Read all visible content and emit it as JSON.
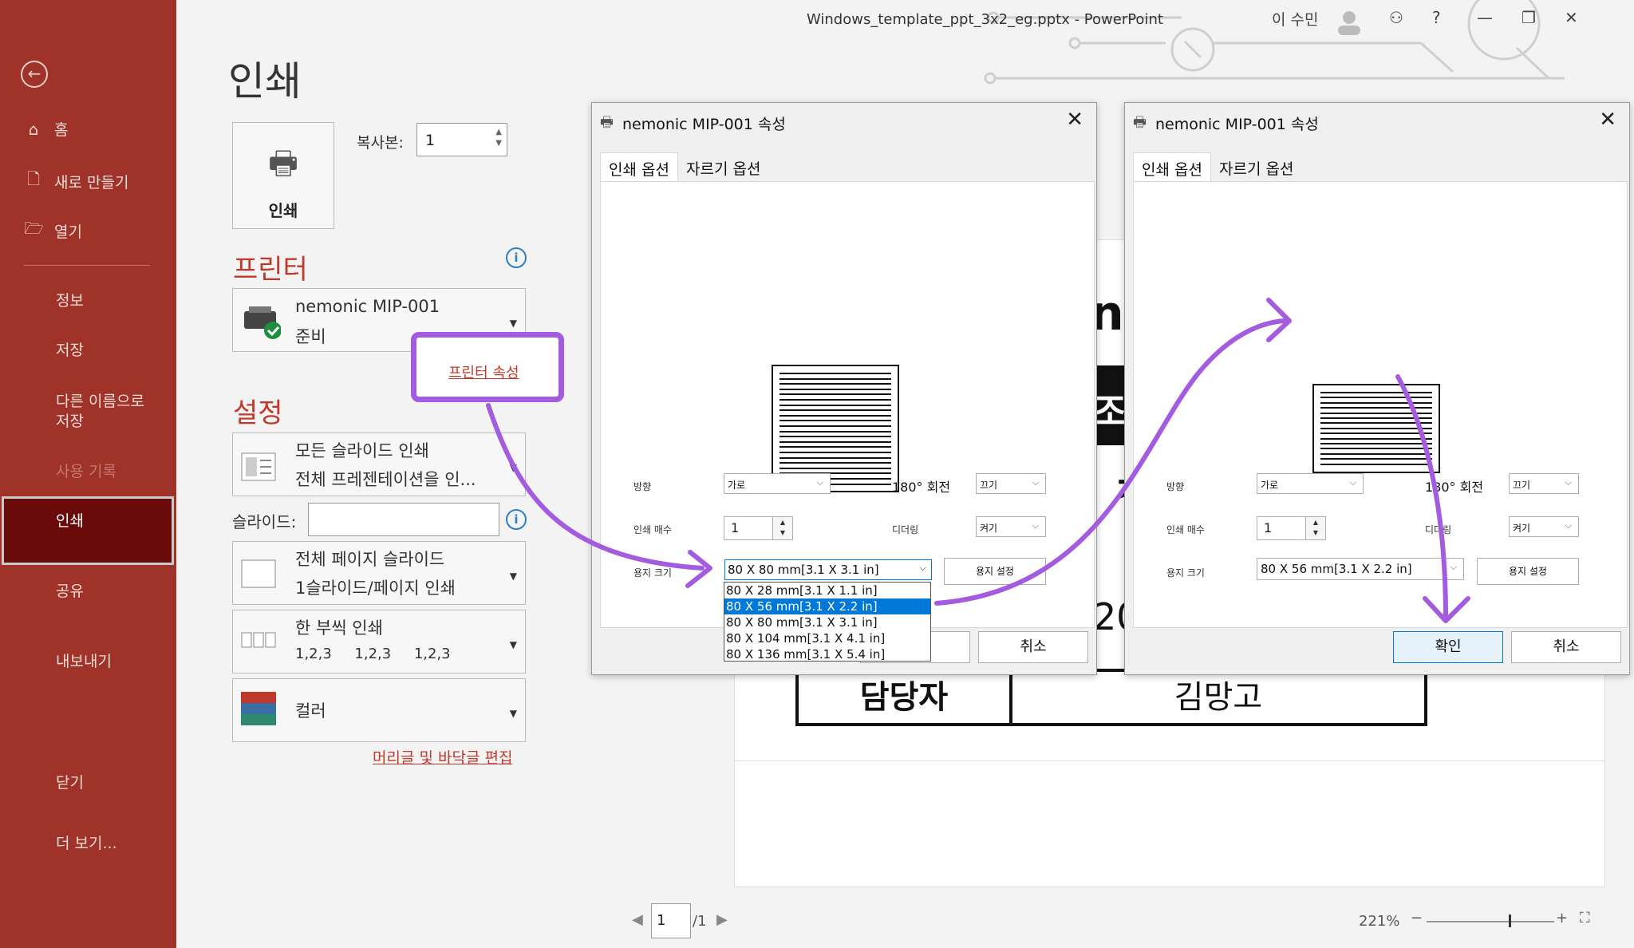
{
  "window": {
    "title": "Windows_template_ppt_3x2_eg.pptx  -  PowerPoint",
    "user": "이 수민"
  },
  "sidebar": {
    "home": "홈",
    "new": "새로 만들기",
    "open": "열기",
    "info": "정보",
    "save": "저장",
    "save_as_1": "다른 이름으로",
    "save_as_2": "저장",
    "history": "사용 기록",
    "print": "인쇄",
    "share": "공유",
    "export": "내보내기",
    "close": "닫기",
    "more": "더 보기..."
  },
  "print_page": {
    "title": "인쇄",
    "print_button": "인쇄",
    "copies_label": "복사본:",
    "copies_value": "1",
    "printer_heading": "프린터",
    "printer_name": "nemonic MIP-001",
    "printer_status": "준비",
    "printer_properties": "프린터 속성",
    "settings_heading": "설정",
    "slides_range_1": "모든 슬라이드 인쇄",
    "slides_range_2": "전체 프레젠테이션을 인...",
    "slides_label": "슬라이드:",
    "layout_1": "전체 페이지 슬라이드",
    "layout_2": "1슬라이드/페이지 인쇄",
    "collate_1": "한 부씩 인쇄",
    "collate_2": "1,2,3     1,2,3     1,2,3",
    "color": "컬러",
    "header_footer": "머리글 및 바닥글 편집",
    "page_value": "1",
    "page_total": "/1",
    "zoom": "221%"
  },
  "preview": {
    "cell_left": "담당자",
    "cell_right": "김망고",
    "fragment_no": "nc",
    "fragment_jo": "조",
    "fragment_ch": "ㅊ",
    "fragment_20": "20"
  },
  "dialog_left": {
    "title": "nemonic MIP-001 속성",
    "tab_print": "인쇄 옵션",
    "tab_cut": "자르기 옵션",
    "orientation_label": "방향",
    "orientation_value": "가로",
    "rotate_label": "180° 회전",
    "rotate_value": "끄기",
    "copies_label": "인쇄 매수",
    "copies_value": "1",
    "dither_label": "디더링",
    "dither_value": "켜기",
    "paper_label": "용지 크기",
    "paper_value": "80 X 80 mm[3.1 X 3.1 in]",
    "paper_setup": "용지 설정",
    "cancel": "취소",
    "paper_options": [
      "80 X 28 mm[3.1 X 1.1 in]",
      "80 X 56 mm[3.1 X 2.2 in]",
      "80 X 80 mm[3.1 X 3.1 in]",
      "80 X 104 mm[3.1 X 4.1 in]",
      "80 X 136 mm[3.1 X 5.4 in]"
    ]
  },
  "dialog_right": {
    "title": "nemonic MIP-001 속성",
    "tab_print": "인쇄 옵션",
    "tab_cut": "자르기 옵션",
    "orientation_label": "방향",
    "orientation_value": "가로",
    "rotate_label": "180° 회전",
    "rotate_value": "끄기",
    "copies_label": "인쇄 매수",
    "copies_value": "1",
    "dither_label": "디더링",
    "dither_value": "켜기",
    "paper_label": "용지 크기",
    "paper_value": "80 X 56 mm[3.1 X 2.2 in]",
    "paper_setup": "용지 설정",
    "ok": "확인",
    "cancel": "취소"
  },
  "colors": {
    "sidebar": "#9f3329",
    "accent_text": "#c0392b",
    "highlight": "#a35be0",
    "selection": "#0078d7"
  }
}
